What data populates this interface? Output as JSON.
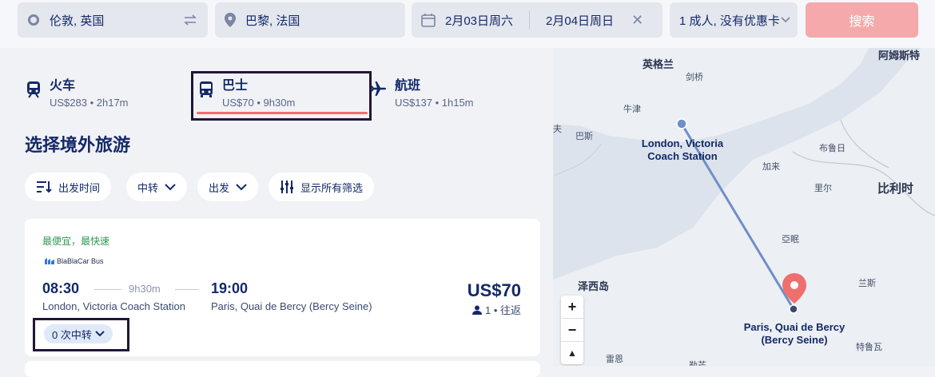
{
  "search": {
    "origin": "伦敦, 英国",
    "destination": "巴黎, 法国",
    "depart_date": "2月03日周六",
    "return_date": "2月04日周日",
    "passengers": "1 成人, 没有优惠卡",
    "search_label": "搜索"
  },
  "tabs": [
    {
      "label": "火车",
      "summary": "US$283 • 2h17m"
    },
    {
      "label": "巴士",
      "summary": "US$70 • 9h30m"
    },
    {
      "label": "航班",
      "summary": "US$137 • 1h15m"
    }
  ],
  "page_title": "选择境外旅游",
  "filters": {
    "departure_time": "出发时间",
    "transfers": "中转",
    "departure": "出发",
    "show_all": "显示所有筛选"
  },
  "result": {
    "badge": "最便宜，最快速",
    "operator": "BlaBlaCar Bus",
    "depart_time": "08:30",
    "duration": "9h30m",
    "arrive_time": "19:00",
    "depart_station": "London, Victoria Coach Station",
    "arrive_station": "Paris, Quai de Bercy (Bercy Seine)",
    "price": "US$70",
    "passengers": "1 • 往返",
    "transfers": "0 次中转"
  },
  "map": {
    "labels": {
      "england": "英格兰",
      "cambridge": "剑桥",
      "amsterdam": "阿姆斯特",
      "oxford": "牛津",
      "bath": "巴斯",
      "edge_left": "夫",
      "brussels": "布鲁日",
      "calais": "加来",
      "lille": "里尔",
      "belgium": "比利时",
      "amiens": "亞眠",
      "jersey": "泽西岛",
      "reims": "兰斯",
      "rennes": "雷恩",
      "le_mans": "勒芒",
      "troyes": "特鲁瓦"
    },
    "origin_station": "London, Victoria Coach Station",
    "dest_station": "Paris, Quai de Bercy (Bercy Seine)",
    "zoom_in": "+",
    "zoom_out": "−",
    "compass": "▲"
  },
  "colors": {
    "accent": "#ef6f6c",
    "search_button": "#f5a9ab",
    "route_line": "#6f8fc7",
    "highlight_box": "#221636",
    "badge_green": "#2f9b55"
  }
}
